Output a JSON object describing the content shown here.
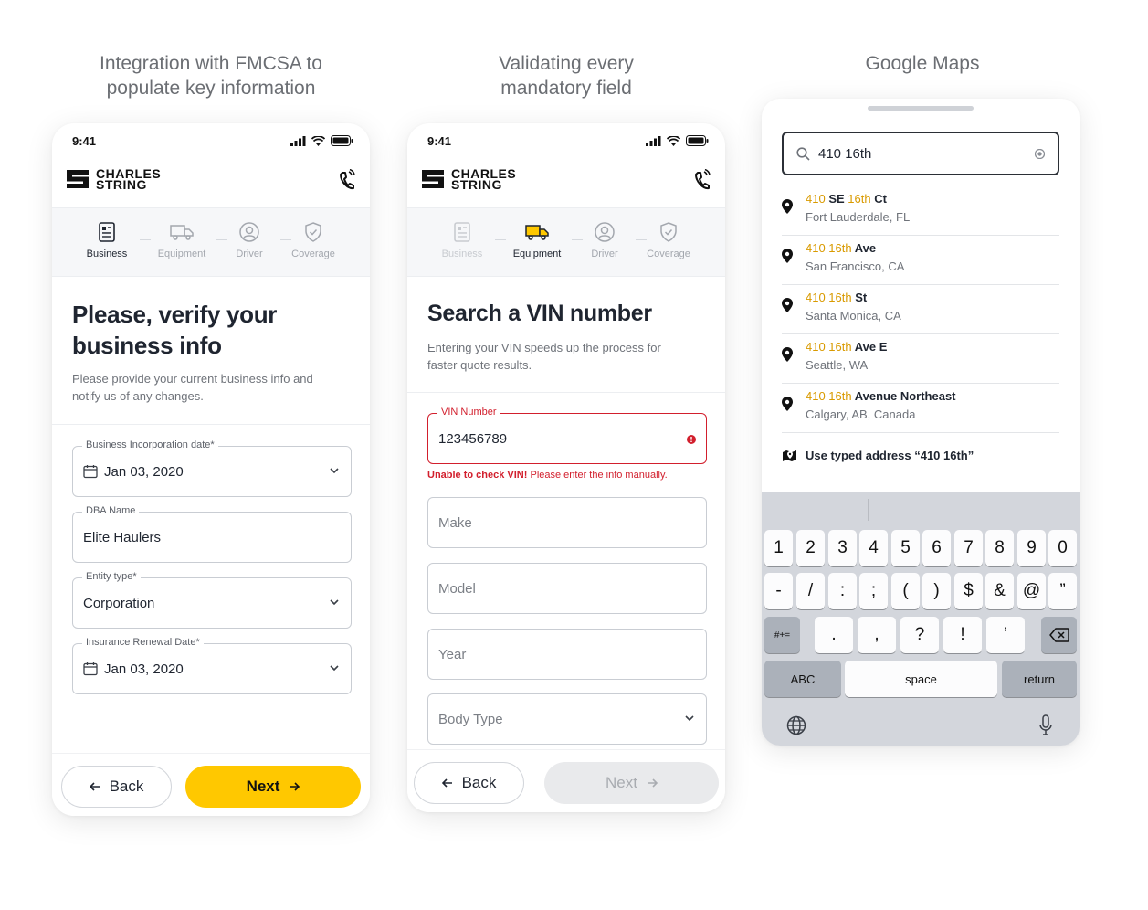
{
  "captions": {
    "left": [
      "Integration with FMCSA to",
      "populate key information"
    ],
    "middle": [
      "Validating every",
      "mandatory field"
    ],
    "right": "Google Maps"
  },
  "colors": {
    "accent": "#ffc800",
    "error": "#d21f2d",
    "highlight": "#d99a00"
  },
  "status_time": "9:41",
  "brand": {
    "line1": "CHARLES",
    "line2": "STRING"
  },
  "steps": [
    "Business",
    "Equipment",
    "Driver",
    "Coverage"
  ],
  "screen1": {
    "title_line1": "Please, verify your",
    "title_line2": "business info",
    "subtitle_line1": "Please provide your current business info and",
    "subtitle_line2": "notify us of any changes.",
    "fields": [
      {
        "label": "Business Incorporation date*",
        "value": "Jan 03, 2020"
      },
      {
        "label": "DBA Name",
        "value": "Elite Haulers"
      },
      {
        "label": "Entity type*",
        "value": "Corporation"
      },
      {
        "label": "Insurance Renewal Date*",
        "value": "Jan 03, 2020"
      }
    ],
    "back": "Back",
    "next": "Next"
  },
  "screen2": {
    "title": "Search a VIN number",
    "subtitle_line1": "Entering your VIN speeds up the process for",
    "subtitle_line2": "faster quote results.",
    "vin_label": "VIN Number",
    "vin_value": "123456789",
    "error_bold": "Unable to check VIN!",
    "error_rest": " Please enter the info manually.",
    "placeholders": [
      "Make",
      "Model",
      "Year",
      "Body Type"
    ],
    "back": "Back",
    "next": "Next"
  },
  "screen3": {
    "search_value": "410 16th",
    "results": [
      {
        "hl1": "410",
        "mid": " SE ",
        "hl2": "16th",
        "rest": " Ct",
        "sub": "Fort Lauderdale, FL"
      },
      {
        "hl1": "410 16th",
        "mid": "",
        "hl2": "",
        "rest": " Ave",
        "sub": "San Francisco, CA"
      },
      {
        "hl1": "410 16th",
        "mid": "",
        "hl2": "",
        "rest": " St",
        "sub": "Santa Monica, CA"
      },
      {
        "hl1": "410 16th",
        "mid": "",
        "hl2": "",
        "rest": " Ave E",
        "sub": "Seattle, WA"
      },
      {
        "hl1": "410 16th",
        "mid": "",
        "hl2": "",
        "rest": " Avenue Northeast",
        "sub": "Calgary, AB, Canada"
      }
    ],
    "use_typed": "Use typed address “410 16th”",
    "keyboard": {
      "row1": [
        "1",
        "2",
        "3",
        "4",
        "5",
        "6",
        "7",
        "8",
        "9",
        "0"
      ],
      "row2": [
        "-",
        "/",
        ":",
        ";",
        "(",
        ")",
        "$",
        "&",
        "@",
        "”"
      ],
      "row3": [
        ".",
        ",",
        "?",
        "!",
        "’"
      ],
      "symbols": "#+=",
      "abc": "ABC",
      "space": "space",
      "return": "return"
    }
  }
}
